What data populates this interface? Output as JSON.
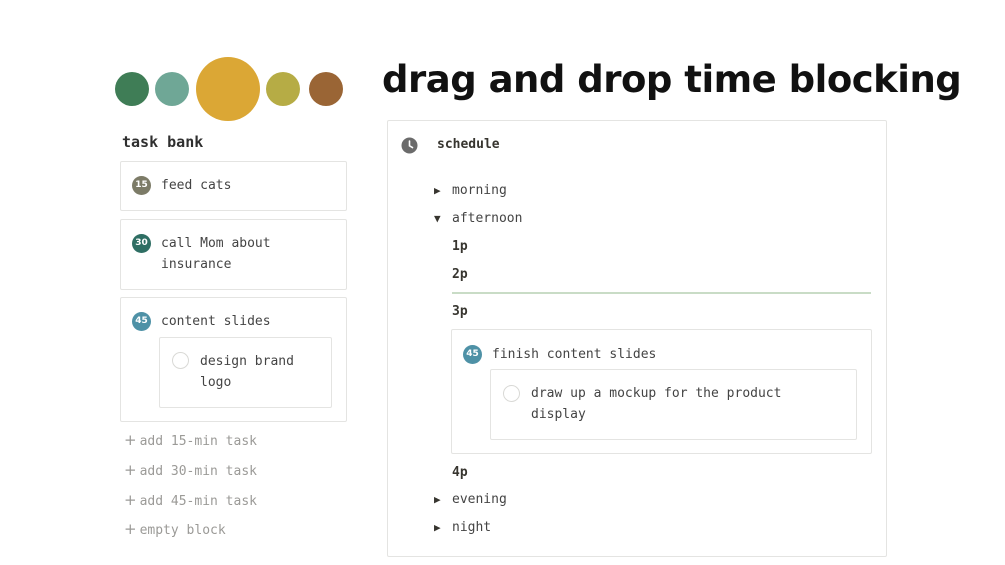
{
  "header": {
    "title": "drag and drop time blocking",
    "palette": [
      "#3f7d56",
      "#6fa796",
      "#dba735",
      "#b6ac45",
      "#9a6535"
    ]
  },
  "task_bank": {
    "title": "task bank",
    "tasks": [
      {
        "minutes": "15",
        "badge_color": "#7c7b67",
        "label": "feed cats"
      },
      {
        "minutes": "30",
        "badge_color": "#2e6e63",
        "label": "call Mom about insurance"
      },
      {
        "minutes": "45",
        "badge_color": "#4e91a6",
        "label": "content slides",
        "subtask": "design brand logo"
      }
    ],
    "add_buttons": [
      "add 15-min task",
      "add 30-min task",
      "add 45-min task",
      "empty block"
    ]
  },
  "schedule": {
    "title": "schedule",
    "icon": "clock-icon",
    "sections": [
      {
        "label": "morning",
        "expanded": false
      },
      {
        "label": "afternoon",
        "expanded": true
      },
      {
        "label": "evening",
        "expanded": false
      },
      {
        "label": "night",
        "expanded": false
      }
    ],
    "hours": [
      "1p",
      "2p",
      "3p",
      "4p"
    ],
    "block": {
      "minutes": "45",
      "badge_color": "#4e91a6",
      "label": "finish content slides",
      "subtask": "draw up a mockup for the product display"
    }
  }
}
